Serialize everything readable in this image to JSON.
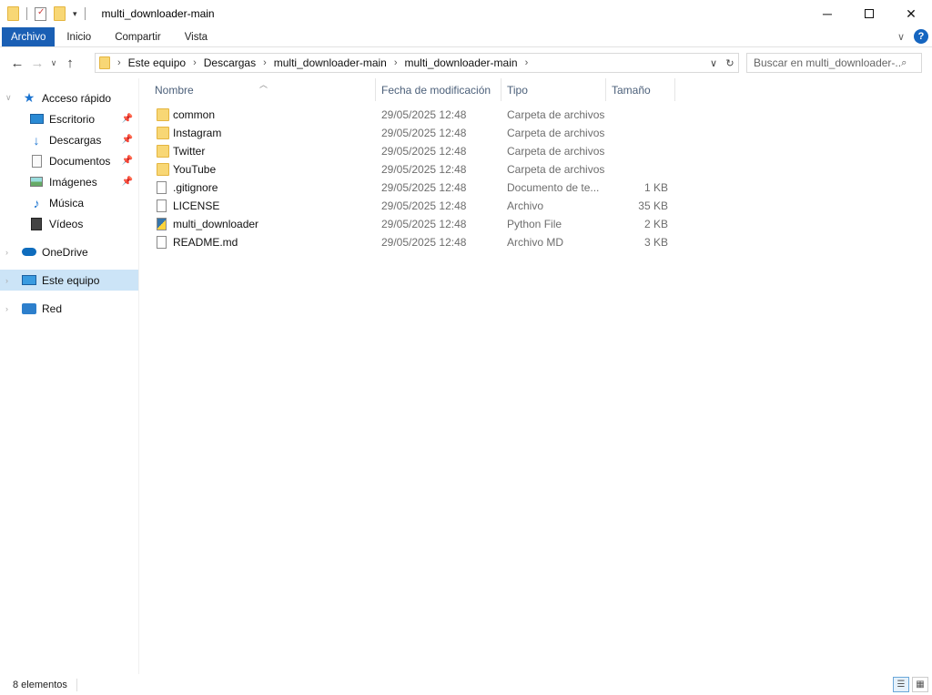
{
  "window": {
    "title": "multi_downloader-main",
    "controls": {
      "minimize": "─",
      "close": "✕"
    }
  },
  "ribbon": {
    "tabs": [
      "Archivo",
      "Inicio",
      "Compartir",
      "Vista"
    ],
    "help": "?"
  },
  "address": {
    "crumbs": [
      "Este equipo",
      "Descargas",
      "multi_downloader-main",
      "multi_downloader-main"
    ],
    "separator": "›"
  },
  "search": {
    "placeholder": "Buscar en multi_downloader-..."
  },
  "sidebar": {
    "quick_access": "Acceso rápido",
    "pinned": [
      {
        "label": "Escritorio",
        "icon": "desktop-icon",
        "pinned": true
      },
      {
        "label": "Descargas",
        "icon": "download-arrow-icon",
        "pinned": true
      },
      {
        "label": "Documentos",
        "icon": "documents-icon",
        "pinned": true
      },
      {
        "label": "Imágenes",
        "icon": "pictures-icon",
        "pinned": true
      },
      {
        "label": "Música",
        "icon": "music-note-icon",
        "pinned": false
      },
      {
        "label": "Vídeos",
        "icon": "video-icon",
        "pinned": false
      }
    ],
    "onedrive": "OneDrive",
    "this_pc": "Este equipo",
    "network": "Red"
  },
  "columns": {
    "name": "Nombre",
    "date": "Fecha de modificación",
    "type": "Tipo",
    "size": "Tamaño"
  },
  "files": [
    {
      "name": "common",
      "date": "29/05/2025 12:48",
      "type": "Carpeta de archivos",
      "size": "",
      "icon": "folder-icon"
    },
    {
      "name": "Instagram",
      "date": "29/05/2025 12:48",
      "type": "Carpeta de archivos",
      "size": "",
      "icon": "folder-icon"
    },
    {
      "name": "Twitter",
      "date": "29/05/2025 12:48",
      "type": "Carpeta de archivos",
      "size": "",
      "icon": "folder-icon"
    },
    {
      "name": "YouTube",
      "date": "29/05/2025 12:48",
      "type": "Carpeta de archivos",
      "size": "",
      "icon": "folder-icon"
    },
    {
      "name": ".gitignore",
      "date": "29/05/2025 12:48",
      "type": "Documento de te...",
      "size": "1 KB",
      "icon": "text-file-icon"
    },
    {
      "name": "LICENSE",
      "date": "29/05/2025 12:48",
      "type": "Archivo",
      "size": "35 KB",
      "icon": "file-icon"
    },
    {
      "name": "multi_downloader",
      "date": "29/05/2025 12:48",
      "type": "Python File",
      "size": "2 KB",
      "icon": "python-file-icon"
    },
    {
      "name": "README.md",
      "date": "29/05/2025 12:48",
      "type": "Archivo MD",
      "size": "3 KB",
      "icon": "file-icon"
    }
  ],
  "status": {
    "count": "8 elementos"
  },
  "colors": {
    "accent": "#1a5fb4",
    "selected": "#cce4f7",
    "header_text": "#4c607a"
  }
}
